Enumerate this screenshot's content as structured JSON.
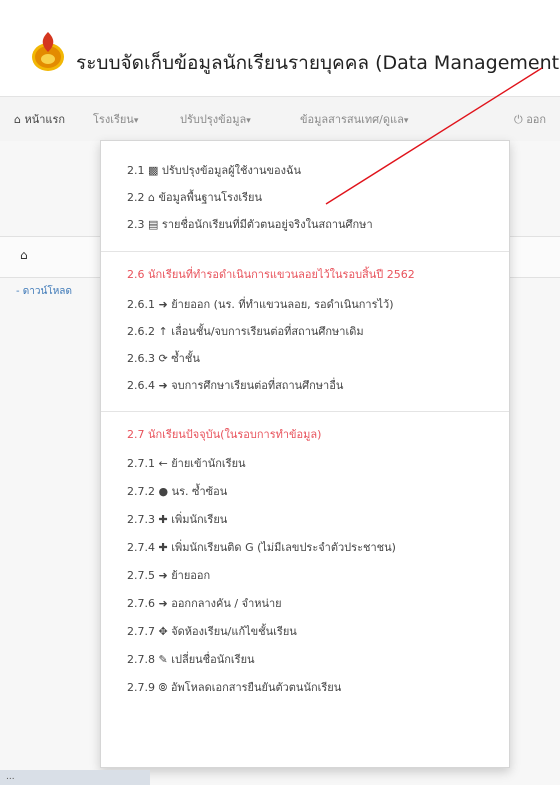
{
  "app": {
    "title": "ระบบจัดเก็บข้อมูลนักเรียนรายบุคคล (Data Management"
  },
  "navbar": {
    "home": "หน้าแรก",
    "school": "โรงเรียน",
    "update": "ปรับปรุงข้อมูล",
    "report": "ข้อมูลสารสนเทศ/ดูแล",
    "logout": "ออก"
  },
  "page": {
    "left_link": "- ดาวน์โหลด"
  },
  "status": {
    "text": "..."
  },
  "menu": {
    "group1": [
      {
        "num": "2.1",
        "icon": "user-icon",
        "label": "ปรับปรุงข้อมูลผู้ใช้งานของฉัน"
      },
      {
        "num": "2.2",
        "icon": "home-icon",
        "label": "ข้อมูลพื้นฐานโรงเรียน"
      },
      {
        "num": "2.3",
        "icon": "list-icon",
        "label": "รายชื่อนักเรียนที่มีตัวตนอยู่จริงในสถานศึกษา"
      }
    ],
    "group2_header": "2.6 นักเรียนที่ทำรอดำเนินการแขวนลอยไว้ในรอบสิ้นปี 2562",
    "group2": [
      {
        "num": "2.6.1",
        "icon": "arrow-right-icon",
        "label": "ย้ายออก (นร. ที่ทำแขวนลอย, รอดำเนินการไว้)"
      },
      {
        "num": "2.6.2",
        "icon": "arrow-up-icon",
        "label": "เลื่อนชั้น/จบการเรียนต่อที่สถานศึกษาเดิม"
      },
      {
        "num": "2.6.3",
        "icon": "refresh-icon",
        "label": "ซ้ำชั้น"
      },
      {
        "num": "2.6.4",
        "icon": "arrow-right-icon",
        "label": "จบการศึกษาเรียนต่อที่สถานศึกษาอื่น"
      }
    ],
    "group3_header": "2.7 นักเรียนปัจจุบัน(ในรอบการทำข้อมูล)",
    "group3": [
      {
        "num": "2.7.1",
        "icon": "arrow-left-icon",
        "label": "ย้ายเข้านักเรียน"
      },
      {
        "num": "2.7.2",
        "icon": "circle-icon",
        "label": "นร. ซ้ำซ้อน"
      },
      {
        "num": "2.7.3",
        "icon": "plus-icon",
        "label": "เพิ่มนักเรียน"
      },
      {
        "num": "2.7.4",
        "icon": "plus-icon",
        "label": "เพิ่มนักเรียนติด G (ไม่มีเลขประจำตัวประชาชน)"
      },
      {
        "num": "2.7.5",
        "icon": "arrow-right-icon",
        "label": "ย้ายออก"
      },
      {
        "num": "2.7.6",
        "icon": "arrow-right-icon",
        "label": "ออกกลางคัน / จำหน่าย"
      },
      {
        "num": "2.7.7",
        "icon": "move-icon",
        "label": "จัดห้องเรียน/แก้ไขชั้นเรียน"
      },
      {
        "num": "2.7.8",
        "icon": "pencil-icon",
        "label": "เปลี่ยนชื่อนักเรียน"
      },
      {
        "num": "2.7.9",
        "icon": "upload-icon",
        "label": "อัพโหลดเอกสารยืนยันตัวตนนักเรียน"
      }
    ]
  },
  "colors": {
    "header_red": "#e8525b",
    "pointer_red": "#e0131b",
    "link_blue": "#3e79b8"
  }
}
